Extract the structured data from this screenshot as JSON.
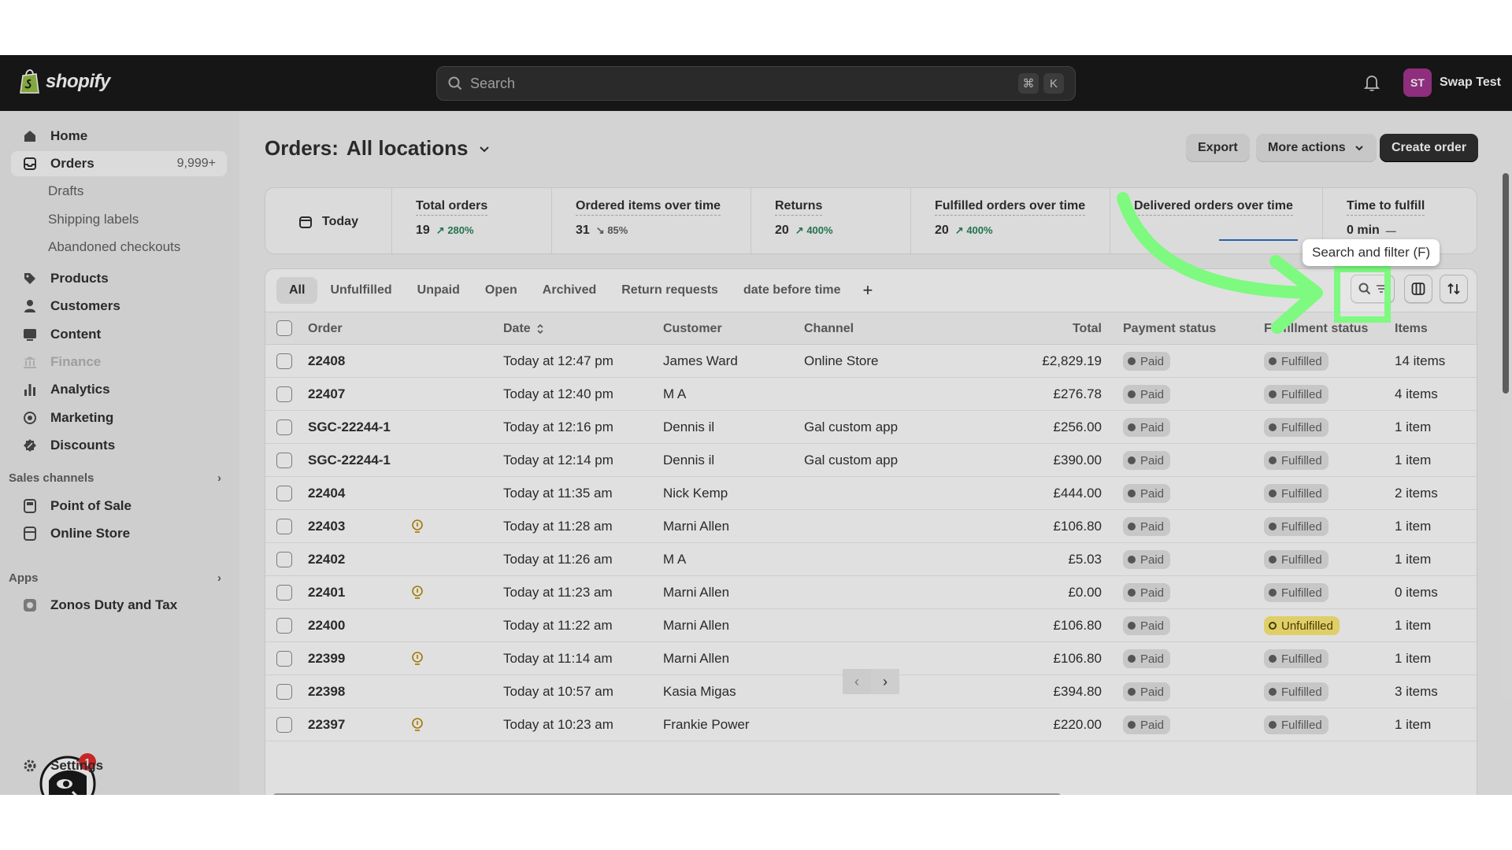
{
  "topbar": {
    "brand": "shopify",
    "search_placeholder": "Search",
    "shortcut_keys": [
      "⌘",
      "K"
    ],
    "user_initials": "ST",
    "user_name": "Swap Test"
  },
  "sidebar": {
    "items": [
      {
        "label": "Home",
        "icon": "home-icon"
      },
      {
        "label": "Orders",
        "icon": "orders-icon",
        "count": "9,999+"
      },
      {
        "label": "Products",
        "icon": "tag-icon"
      },
      {
        "label": "Customers",
        "icon": "person-icon"
      },
      {
        "label": "Content",
        "icon": "image-icon"
      },
      {
        "label": "Finance",
        "icon": "bank-icon"
      },
      {
        "label": "Analytics",
        "icon": "bar-chart-icon"
      },
      {
        "label": "Marketing",
        "icon": "target-icon"
      },
      {
        "label": "Discounts",
        "icon": "discount-icon"
      }
    ],
    "order_subitems": [
      "Drafts",
      "Shipping labels",
      "Abandoned checkouts"
    ],
    "sales_channels_heading": "Sales channels",
    "sales_channels": [
      "Point of Sale",
      "Online Store"
    ],
    "apps_heading": "Apps",
    "apps": [
      "Zonos Duty and Tax"
    ],
    "notification_count": "1",
    "settings_label": "Settings"
  },
  "header": {
    "title_prefix": "Orders:",
    "title_location": "All locations",
    "export_label": "Export",
    "more_actions_label": "More actions",
    "create_order_label": "Create order"
  },
  "metrics": {
    "date_label": "Today",
    "items": [
      {
        "label": "Total orders",
        "value": "19",
        "change": "280%",
        "direction": "up"
      },
      {
        "label": "Ordered items over time",
        "value": "31",
        "change": "85%",
        "direction": "down"
      },
      {
        "label": "Returns",
        "value": "20",
        "change": "400%",
        "direction": "up"
      },
      {
        "label": "Fulfilled orders over time",
        "value": "20",
        "change": "400%",
        "direction": "up"
      },
      {
        "label": "Delivered orders over time",
        "value": "—",
        "change": "",
        "direction": "none"
      },
      {
        "label": "Time to fulfill",
        "value": "0 min",
        "change": "—",
        "direction": "none"
      }
    ]
  },
  "tabs": [
    "All",
    "Unfulfilled",
    "Unpaid",
    "Open",
    "Archived",
    "Return requests",
    "date before time",
    "+"
  ],
  "tooltip": "Search and filter (F)",
  "columns": {
    "order": "Order",
    "date": "Date",
    "customer": "Customer",
    "channel": "Channel",
    "total": "Total",
    "payment": "Payment status",
    "fulfillment": "Fulfillment status",
    "items": "Items"
  },
  "orders": [
    {
      "order": "22408",
      "note": false,
      "date": "Today at 12:47 pm",
      "customer": "James Ward",
      "channel": "Online Store",
      "total": "£2,829.19",
      "payment": "Paid",
      "fulfillment": "Fulfilled",
      "items": "14 items"
    },
    {
      "order": "22407",
      "note": false,
      "date": "Today at 12:40 pm",
      "customer": "M A",
      "channel": "",
      "total": "£276.78",
      "payment": "Paid",
      "fulfillment": "Fulfilled",
      "items": "4 items"
    },
    {
      "order": "SGC-22244-1",
      "note": false,
      "date": "Today at 12:16 pm",
      "customer": "Dennis il",
      "channel": "Gal custom app",
      "total": "£256.00",
      "payment": "Paid",
      "fulfillment": "Fulfilled",
      "items": "1 item"
    },
    {
      "order": "SGC-22244-1",
      "note": false,
      "date": "Today at 12:14 pm",
      "customer": "Dennis il",
      "channel": "Gal custom app",
      "total": "£390.00",
      "payment": "Paid",
      "fulfillment": "Fulfilled",
      "items": "1 item"
    },
    {
      "order": "22404",
      "note": false,
      "date": "Today at 11:35 am",
      "customer": "Nick Kemp",
      "channel": "",
      "total": "£444.00",
      "payment": "Paid",
      "fulfillment": "Fulfilled",
      "items": "2 items"
    },
    {
      "order": "22403",
      "note": true,
      "date": "Today at 11:28 am",
      "customer": "Marni Allen",
      "channel": "",
      "total": "£106.80",
      "payment": "Paid",
      "fulfillment": "Fulfilled",
      "items": "1 item"
    },
    {
      "order": "22402",
      "note": false,
      "date": "Today at 11:26 am",
      "customer": "M A",
      "channel": "",
      "total": "£5.03",
      "payment": "Paid",
      "fulfillment": "Fulfilled",
      "items": "1 item"
    },
    {
      "order": "22401",
      "note": true,
      "date": "Today at 11:23 am",
      "customer": "Marni Allen",
      "channel": "",
      "total": "£0.00",
      "payment": "Paid",
      "fulfillment": "Fulfilled",
      "items": "0 items"
    },
    {
      "order": "22400",
      "note": false,
      "date": "Today at 11:22 am",
      "customer": "Marni Allen",
      "channel": "",
      "total": "£106.80",
      "payment": "Paid",
      "fulfillment": "Unfulfilled",
      "items": "1 item"
    },
    {
      "order": "22399",
      "note": true,
      "date": "Today at 11:14 am",
      "customer": "Marni Allen",
      "channel": "",
      "total": "£106.80",
      "payment": "Paid",
      "fulfillment": "Fulfilled",
      "items": "1 item"
    },
    {
      "order": "22398",
      "note": false,
      "date": "Today at 10:57 am",
      "customer": "Kasia Migas",
      "channel": "",
      "total": "£394.80",
      "payment": "Paid",
      "fulfillment": "Fulfilled",
      "items": "3 items"
    },
    {
      "order": "22397",
      "note": true,
      "date": "Today at 10:23 am",
      "customer": "Frankie Power",
      "channel": "",
      "total": "£220.00",
      "payment": "Paid",
      "fulfillment": "Fulfilled",
      "items": "1 item"
    }
  ],
  "colors": {
    "highlight": "#7dfa7f",
    "topbar": "#1a1a1a",
    "avatar": "#a2358e",
    "positive": "#29845a",
    "unfulfilled": "#ffeb78"
  }
}
